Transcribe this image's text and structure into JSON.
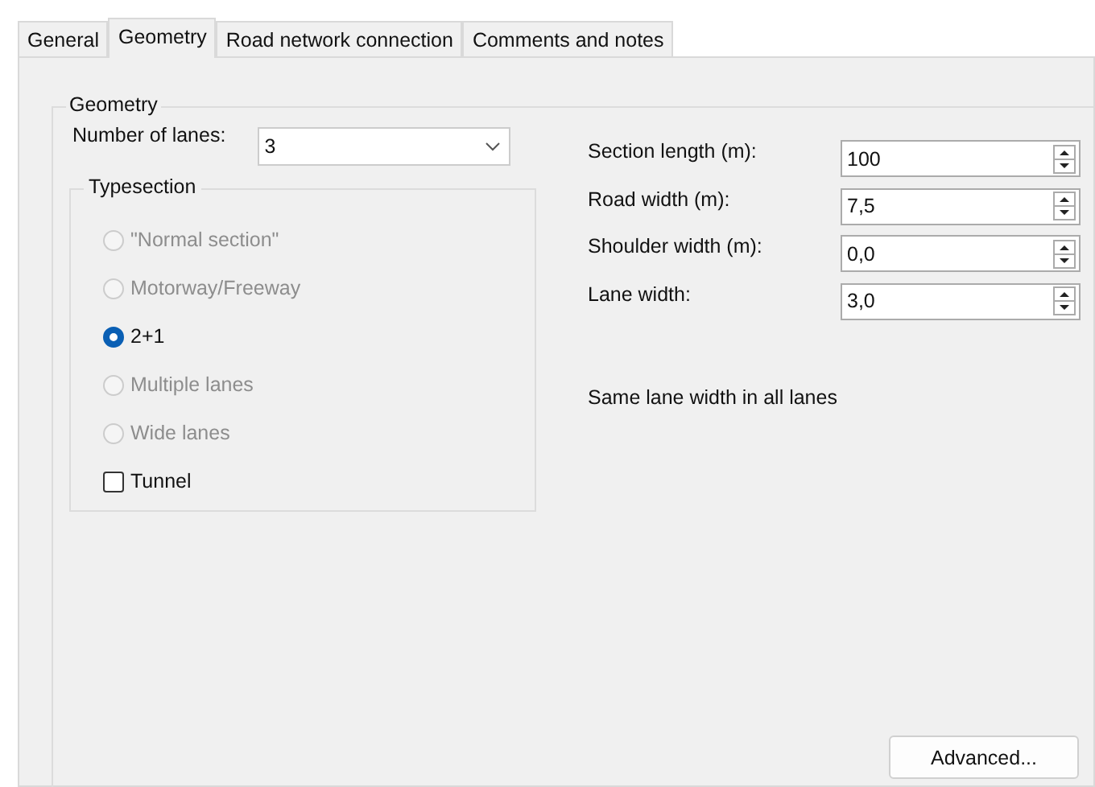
{
  "tabs": [
    {
      "label": "General",
      "selected": false
    },
    {
      "label": "Geometry",
      "selected": true
    },
    {
      "label": "Road network connection",
      "selected": false
    },
    {
      "label": "Comments and notes",
      "selected": false
    }
  ],
  "geometry": {
    "title": "Geometry",
    "lanes_label": "Number of lanes:",
    "lanes_value": "3",
    "typesection": {
      "title": "Typesection",
      "options": [
        {
          "kind": "radio",
          "label": "\"Normal section\"",
          "selected": false,
          "disabled": true
        },
        {
          "kind": "radio",
          "label": "Motorway/Freeway",
          "selected": false,
          "disabled": true
        },
        {
          "kind": "radio",
          "label": "2+1",
          "selected": true,
          "disabled": false
        },
        {
          "kind": "radio",
          "label": "Multiple lanes",
          "selected": false,
          "disabled": true
        },
        {
          "kind": "radio",
          "label": "Wide lanes",
          "selected": false,
          "disabled": true
        },
        {
          "kind": "checkbox",
          "label": "Tunnel",
          "checked": false,
          "disabled": false
        }
      ]
    },
    "fields": [
      {
        "label": "Section length (m):",
        "value": "100"
      },
      {
        "label": "Road width (m):",
        "value": "7,5"
      },
      {
        "label": "Shoulder width (m):",
        "value": "0,0"
      },
      {
        "label": "Lane width:",
        "value": "3,0"
      }
    ],
    "note": "Same lane width in all lanes",
    "advanced_button": "Advanced..."
  }
}
